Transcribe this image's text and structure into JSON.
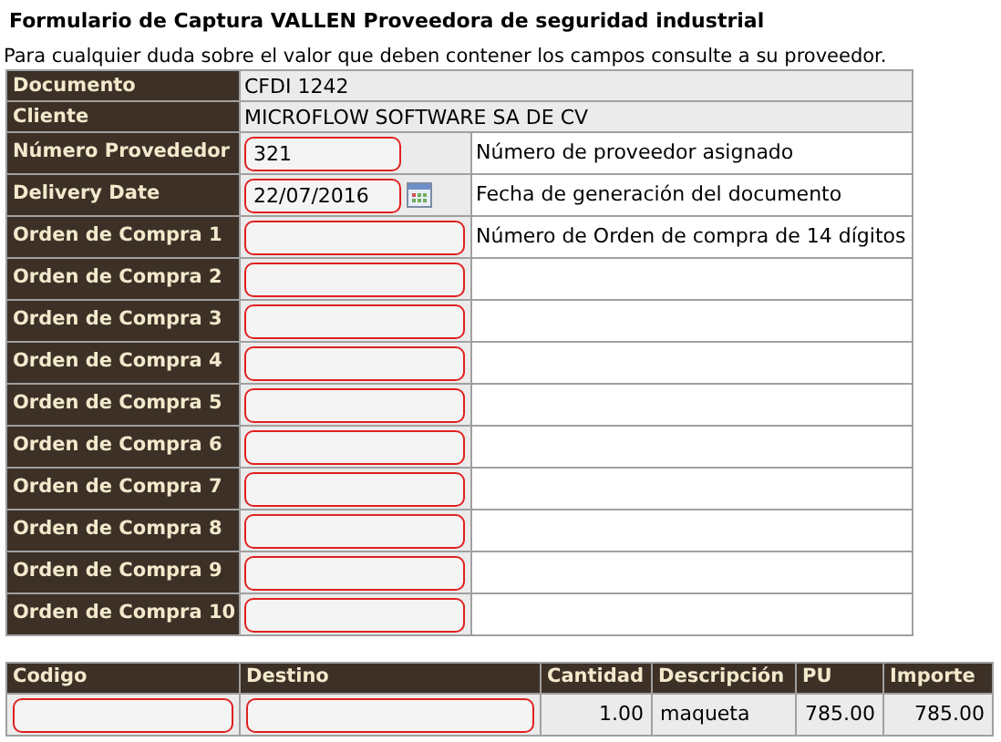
{
  "title": "Formulario de Captura VALLEN Proveedora de seguridad industrial",
  "intro": "Para cualquier duda sobre el valor que deben contener los campos consulte a su proveedor.",
  "fields": [
    {
      "label": "Documento",
      "kind": "text",
      "value": "CFDI 1242"
    },
    {
      "label": "Cliente",
      "kind": "text",
      "value": "MICROFLOW SOFTWARE SA DE CV"
    },
    {
      "label": "Número Provededor",
      "kind": "input",
      "value": "321",
      "hint": "Número de proveedor asignado"
    },
    {
      "label": "Delivery Date",
      "kind": "date",
      "value": "22/07/2016",
      "hint": "Fecha de generación del documento"
    },
    {
      "label": "Orden de Compra 1",
      "kind": "input",
      "hint": "Número de Orden de compra de 14 dígitos"
    },
    {
      "label": "Orden de Compra 2",
      "kind": "input"
    },
    {
      "label": "Orden de Compra 3",
      "kind": "input"
    },
    {
      "label": "Orden de Compra 4",
      "kind": "input"
    },
    {
      "label": "Orden de Compra 5",
      "kind": "input"
    },
    {
      "label": "Orden de Compra 6",
      "kind": "input"
    },
    {
      "label": "Orden de Compra 7",
      "kind": "input"
    },
    {
      "label": "Orden de Compra 8",
      "kind": "input"
    },
    {
      "label": "Orden de Compra 9",
      "kind": "input"
    },
    {
      "label": "Orden de Compra 10",
      "kind": "input"
    }
  ],
  "items_table": {
    "columns": [
      "Codigo",
      "Destino",
      "Cantidad",
      "Descripción",
      "PU",
      "Importe"
    ],
    "rows": [
      [
        {
          "kind": "input"
        },
        {
          "kind": "input"
        },
        {
          "kind": "number",
          "value": "1.00"
        },
        {
          "kind": "text",
          "value": "maqueta"
        },
        {
          "kind": "number",
          "value": "785.00"
        },
        {
          "kind": "number",
          "value": "785.00"
        }
      ]
    ]
  }
}
